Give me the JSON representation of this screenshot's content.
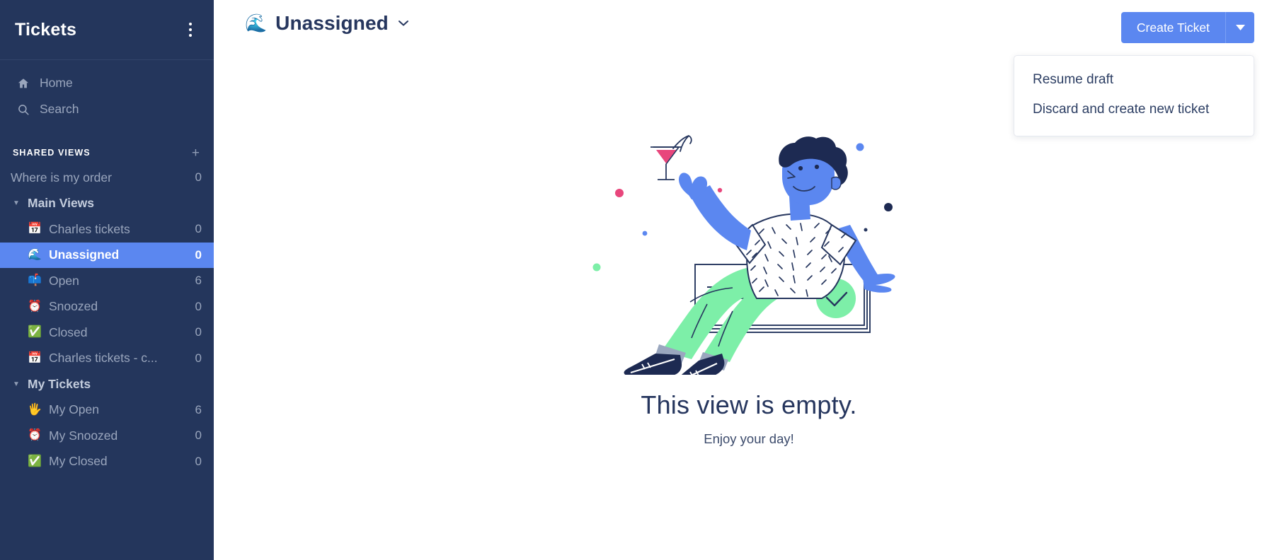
{
  "sidebar": {
    "title": "Tickets",
    "menu_icon": "kebab-menu-icon",
    "nav": [
      {
        "icon": "home-icon",
        "label": "Home"
      },
      {
        "icon": "search-icon",
        "label": "Search"
      }
    ],
    "section": {
      "label": "SHARED VIEWS",
      "add_icon": "plus-icon"
    },
    "views": [
      {
        "type": "plain",
        "emoji": "",
        "label": "Where is my order",
        "count": "0",
        "selected": false
      },
      {
        "type": "group",
        "emoji": "",
        "label": "Main Views",
        "count": "",
        "selected": false
      },
      {
        "type": "child",
        "emoji": "📅",
        "label": "Charles tickets",
        "count": "0",
        "selected": false
      },
      {
        "type": "child",
        "emoji": "🌊",
        "label": "Unassigned",
        "count": "0",
        "selected": true
      },
      {
        "type": "child",
        "emoji": "📫",
        "label": "Open",
        "count": "6",
        "selected": false
      },
      {
        "type": "child",
        "emoji": "⏰",
        "label": "Snoozed",
        "count": "0",
        "selected": false
      },
      {
        "type": "child",
        "emoji": "✅",
        "label": "Closed",
        "count": "0",
        "selected": false
      },
      {
        "type": "child",
        "emoji": "📅",
        "label": "Charles tickets - c...",
        "count": "0",
        "selected": false
      },
      {
        "type": "group",
        "emoji": "",
        "label": "My Tickets",
        "count": "",
        "selected": false
      },
      {
        "type": "child",
        "emoji": "🖐",
        "label": "My Open",
        "count": "6",
        "selected": false
      },
      {
        "type": "child",
        "emoji": "⏰",
        "label": "My Snoozed",
        "count": "0",
        "selected": false
      },
      {
        "type": "child",
        "emoji": "✅",
        "label": "My Closed",
        "count": "0",
        "selected": false
      }
    ]
  },
  "header": {
    "view_emoji": "🌊",
    "view_name": "Unassigned",
    "chevron_icon": "chevron-down-icon",
    "create_button": "Create Ticket",
    "create_caret_icon": "caret-down-icon"
  },
  "dropdown": {
    "items": [
      {
        "label": "Resume draft"
      },
      {
        "label": "Discard and create new ticket"
      }
    ]
  },
  "empty_state": {
    "illustration": "person-with-cocktail-sitting-on-cards-illustration",
    "title": "This view is empty.",
    "subtitle": "Enjoy your day!"
  },
  "colors": {
    "sidebar_bg": "#24365c",
    "accent_blue": "#5b87f0",
    "navy_text": "#26365e",
    "muted_text": "#9aa6bd",
    "mint_green": "#7defa8",
    "pink": "#e8467c"
  }
}
